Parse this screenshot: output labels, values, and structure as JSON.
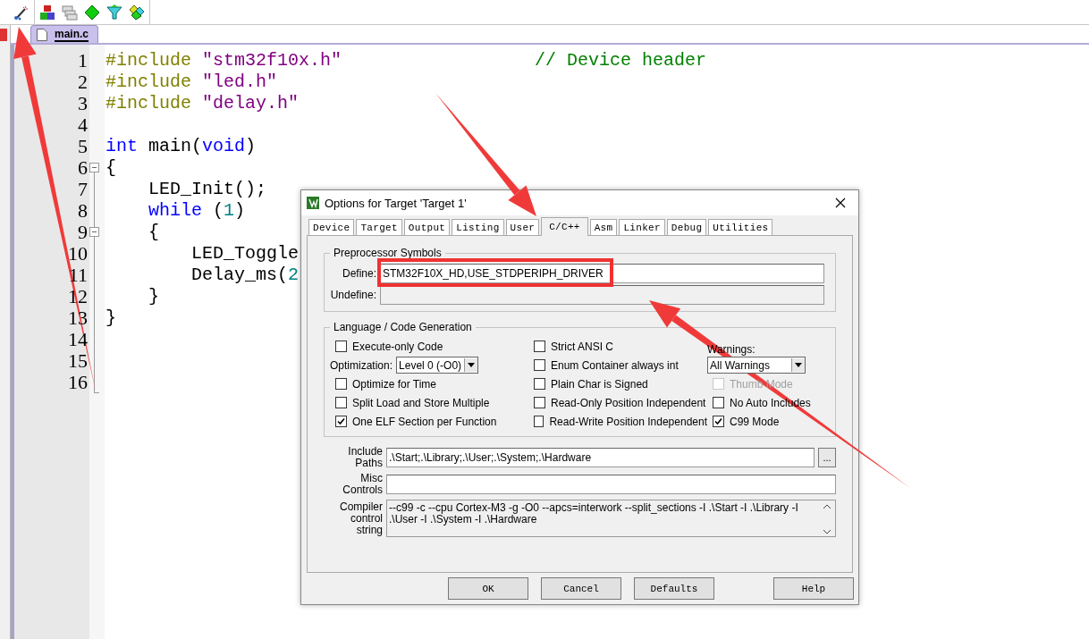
{
  "editor_tabs": [
    {
      "label": "main.c",
      "selected": true
    }
  ],
  "code_lines": [
    {
      "number": "1",
      "fold_start": false,
      "segments": [
        {
          "kind": "preprocessor",
          "text": "#include "
        },
        {
          "kind": "string",
          "text": "\"stm32f10x.h\""
        },
        {
          "kind": "comment",
          "text": "// Device header"
        }
      ]
    },
    {
      "number": "2",
      "fold_start": false,
      "segments": [
        {
          "kind": "preprocessor",
          "text": "#include "
        },
        {
          "kind": "string",
          "text": "\"led.h\""
        }
      ]
    },
    {
      "number": "3",
      "fold_start": false,
      "segments": [
        {
          "kind": "preprocessor",
          "text": "#include "
        },
        {
          "kind": "string",
          "text": "\"delay.h\""
        }
      ]
    },
    {
      "number": "4",
      "fold_start": false
    },
    {
      "number": "5",
      "fold_start": false,
      "segments": [
        {
          "kind": "keyword",
          "text": "int"
        },
        {
          "kind": "plain",
          "text": " main("
        },
        {
          "kind": "keyword",
          "text": "void"
        },
        {
          "kind": "plain",
          "text": ")"
        }
      ]
    },
    {
      "number": "6",
      "fold_start": true,
      "segments": [
        {
          "kind": "plain",
          "text": "{"
        }
      ]
    },
    {
      "number": "7",
      "fold_start": false,
      "segments": [
        {
          "kind": "plain",
          "text": "    LED_Init();"
        }
      ]
    },
    {
      "number": "8",
      "fold_start": false,
      "segments": [
        {
          "kind": "keyword",
          "text": "    while"
        },
        {
          "kind": "plain",
          "text": " ("
        },
        {
          "kind": "number",
          "text": "1"
        },
        {
          "kind": "plain",
          "text": ")"
        }
      ]
    },
    {
      "number": "9",
      "fold_start": true,
      "segments": [
        {
          "kind": "plain",
          "text": "    {"
        }
      ]
    },
    {
      "number": "10",
      "fold_start": false,
      "segments": [
        {
          "kind": "plain",
          "text": "        LED_Toggle"
        }
      ]
    },
    {
      "number": "11",
      "fold_start": false,
      "segments": [
        {
          "kind": "plain",
          "text": "        Delay_ms("
        },
        {
          "kind": "number",
          "text": "2"
        }
      ]
    },
    {
      "number": "12",
      "fold_start": false,
      "segments": [
        {
          "kind": "plain",
          "text": "    }"
        }
      ]
    },
    {
      "number": "13",
      "fold_start": false,
      "segments": [
        {
          "kind": "plain",
          "text": "}"
        }
      ]
    },
    {
      "number": "14",
      "fold_start": false
    },
    {
      "number": "15",
      "fold_start": false
    },
    {
      "number": "16",
      "fold_start": false
    }
  ],
  "dialog": {
    "title": "Options for Target 'Target 1'",
    "tabs": [
      {
        "label": "Device",
        "selected": false
      },
      {
        "label": "Target",
        "selected": false
      },
      {
        "label": "Output",
        "selected": false
      },
      {
        "label": "Listing",
        "selected": false
      },
      {
        "label": "User",
        "selected": false
      },
      {
        "label": "C/C++",
        "selected": true
      },
      {
        "label": "Asm",
        "selected": false
      },
      {
        "label": "Linker",
        "selected": false
      },
      {
        "label": "Debug",
        "selected": false
      },
      {
        "label": "Utilities",
        "selected": false
      }
    ],
    "preprocessor": {
      "title": "Preprocessor Symbols",
      "define": {
        "label": "Define:",
        "value": "STM32F10X_HD,USE_STDPERIPH_DRIVER",
        "highlighted": true
      },
      "undefine": {
        "label": "Undefine:",
        "disabled": true
      }
    },
    "codegen": {
      "title": "Language / Code Generation",
      "columns": [
        [
          {
            "kind": "checkbox",
            "label": "Execute-only Code",
            "checked": false,
            "disabled": false
          },
          {
            "kind": "select",
            "label": "Optimization:",
            "value": "Level 0 (-O0)"
          },
          {
            "kind": "checkbox",
            "label": "Optimize for Time",
            "checked": false,
            "disabled": false
          },
          {
            "kind": "checkbox",
            "label": "Split Load and Store Multiple",
            "checked": false,
            "disabled": false
          },
          {
            "kind": "checkbox",
            "label": "One ELF Section per Function",
            "checked": true,
            "disabled": false
          }
        ],
        [
          {
            "kind": "checkbox",
            "label": "Strict ANSI C",
            "checked": false,
            "disabled": false
          },
          {
            "kind": "checkbox",
            "label": "Enum Container always int",
            "checked": false,
            "disabled": false
          },
          {
            "kind": "checkbox",
            "label": "Plain Char is Signed",
            "checked": false,
            "disabled": false
          },
          {
            "kind": "checkbox",
            "label": "Read-Only Position Independent",
            "checked": false,
            "disabled": false
          },
          {
            "kind": "checkbox",
            "label": "Read-Write Position Independent",
            "checked": false,
            "disabled": false
          }
        ],
        [
          {
            "kind": "label",
            "label": "Warnings:"
          },
          {
            "kind": "select",
            "value": "All Warnings"
          },
          {
            "kind": "checkbox",
            "label": "Thumb Mode",
            "checked": false,
            "disabled": true
          },
          {
            "kind": "checkbox",
            "label": "No Auto Includes",
            "checked": false,
            "disabled": false
          },
          {
            "kind": "checkbox",
            "label": "C99 Mode",
            "checked": true,
            "disabled": false
          }
        ]
      ]
    },
    "include_paths": {
      "label": "Include Paths",
      "value": ".\\Start;.\\Library;.\\User;.\\System;.\\Hardware",
      "browse": "..."
    },
    "misc_controls": {
      "label": "Misc Controls"
    },
    "compiler_string": {
      "label": "Compiler control string",
      "value": "--c99 -c --cpu Cortex-M3 -g -O0 --apcs=interwork --split_sections -I .\\Start -I .\\Library -I .\\User -I .\\System -I .\\Hardware"
    },
    "buttons": [
      "OK",
      "Cancel",
      "Defaults",
      "Help"
    ]
  }
}
